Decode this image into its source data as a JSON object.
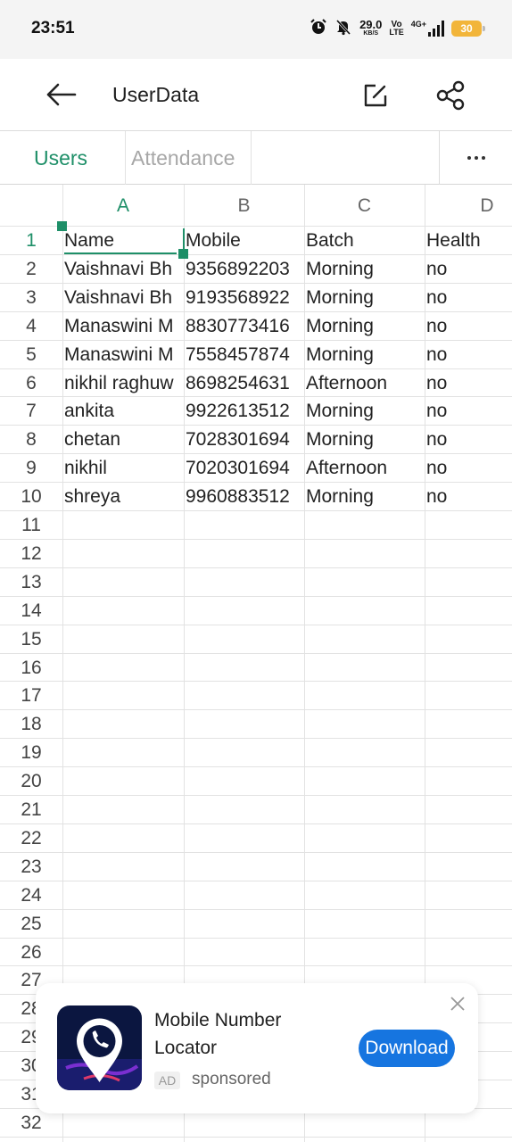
{
  "status": {
    "time": "23:51",
    "speed_value": "29.0",
    "speed_unit": "KB/S",
    "volte_top": "Vo",
    "volte_bottom": "LTE",
    "network": "4G+",
    "battery": "30",
    "icons": [
      "alarm-icon",
      "mute-icon",
      "signal-icon",
      "battery-icon"
    ]
  },
  "app_bar": {
    "title": "UserData",
    "icons": [
      "back-arrow-icon",
      "edit-icon",
      "share-icon"
    ]
  },
  "tabs": [
    {
      "label": "Users",
      "active": true
    },
    {
      "label": "Attendance",
      "active": false
    }
  ],
  "more_icon": "more-horizontal-icon",
  "grid": {
    "columns": [
      "A",
      "B",
      "C",
      "D"
    ],
    "rows": [
      [
        "Name",
        "Mobile",
        "Batch",
        "Health"
      ],
      [
        "Vaishnavi Bh",
        "9356892203",
        "Morning",
        "no"
      ],
      [
        "Vaishnavi Bh",
        "9193568922",
        "Morning",
        "no"
      ],
      [
        "Manaswini M",
        "8830773416",
        "Morning",
        "no"
      ],
      [
        "Manaswini M",
        "7558457874",
        "Morning",
        "no"
      ],
      [
        "nikhil raghuw",
        "8698254631",
        "Afternoon",
        "no"
      ],
      [
        "ankita",
        "9922613512",
        "Morning",
        "no"
      ],
      [
        "chetan",
        "7028301694",
        "Morning",
        "no"
      ],
      [
        "nikhil",
        "7020301694",
        "Afternoon",
        "no"
      ],
      [
        "shreya",
        "9960883512",
        "Morning",
        "no"
      ]
    ],
    "row_numbers": [
      "1",
      "2",
      "3",
      "4",
      "5",
      "6",
      "7",
      "8",
      "9",
      "10",
      "11",
      "12",
      "13",
      "14",
      "15",
      "16",
      "17",
      "18",
      "19",
      "20",
      "21",
      "22",
      "23",
      "24",
      "25",
      "26",
      "27",
      "28",
      "29",
      "30",
      "31",
      "32"
    ],
    "selected_cell": "A1",
    "accent": "#1e8f68"
  },
  "ad": {
    "title": "Mobile Number Locator",
    "badge": "AD",
    "sponsored": "sponsored",
    "button": "Download",
    "button_color": "#1675e0",
    "icons": [
      "phone-location-icon",
      "close-icon"
    ]
  }
}
